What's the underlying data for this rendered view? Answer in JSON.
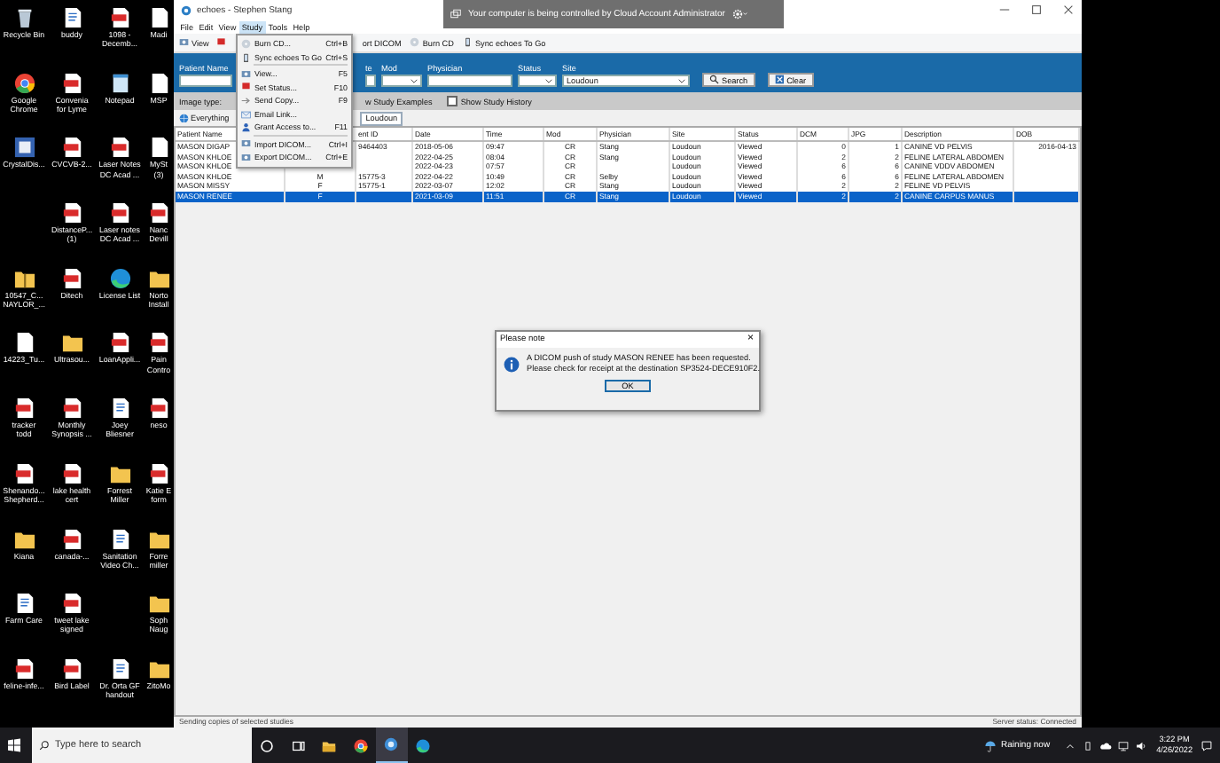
{
  "desktop": {
    "columns": [
      [
        {
          "kind": "recycle",
          "lines": [
            "Recycle Bin"
          ]
        },
        {
          "kind": "chrome",
          "lines": [
            "Google",
            "Chrome"
          ]
        },
        {
          "kind": "app",
          "lines": [
            "CrystalDis..."
          ]
        },
        {
          "kind": "zip",
          "lines": [
            "10547_C...",
            "NAYLOR_..."
          ],
          "after_gap": true
        },
        {
          "kind": "blank",
          "lines": [
            "14223_Tu..."
          ]
        },
        {
          "kind": "pdf",
          "lines": [
            "tracker",
            "todd"
          ]
        },
        {
          "kind": "pdf",
          "lines": [
            "Shenando...",
            "Shepherd..."
          ]
        },
        {
          "kind": "folder",
          "lines": [
            "Kiana"
          ]
        },
        {
          "kind": "doc",
          "lines": [
            "Farm Care"
          ]
        },
        {
          "kind": "pdf",
          "lines": [
            "feline-infe..."
          ]
        }
      ],
      [
        {
          "kind": "doc",
          "lines": [
            "buddy"
          ]
        },
        {
          "kind": "pdf",
          "lines": [
            "Convenia",
            "for Lyme"
          ]
        },
        {
          "kind": "pdf",
          "lines": [
            "CVCVB-2..."
          ]
        },
        {
          "kind": "pdf",
          "lines": [
            "DistanceP...",
            "(1)"
          ]
        },
        {
          "kind": "pdf",
          "lines": [
            "Ditech"
          ]
        },
        {
          "kind": "folder",
          "lines": [
            "Ultrasou..."
          ]
        },
        {
          "kind": "pdf",
          "lines": [
            "Monthly",
            "Synopsis ..."
          ]
        },
        {
          "kind": "pdf",
          "lines": [
            "lake health",
            "cert"
          ]
        },
        {
          "kind": "pdf",
          "lines": [
            "canada-..."
          ]
        },
        {
          "kind": "pdf",
          "lines": [
            "tweet lake",
            "signed"
          ]
        },
        {
          "kind": "pdf",
          "lines": [
            "Bird Label"
          ]
        }
      ],
      [
        {
          "kind": "pdf",
          "lines": [
            "1098 -",
            "Decemb..."
          ]
        },
        {
          "kind": "notepad",
          "lines": [
            "Notepad"
          ]
        },
        {
          "kind": "pdf",
          "lines": [
            "Laser Notes",
            "DC Acad ..."
          ]
        },
        {
          "kind": "pdf",
          "lines": [
            "Laser notes",
            "DC Acad ..."
          ]
        },
        {
          "kind": "edge",
          "lines": [
            "License List"
          ]
        },
        {
          "kind": "pdf",
          "lines": [
            "LoanAppli..."
          ]
        },
        {
          "kind": "doc",
          "lines": [
            "Joey",
            "Bliesner"
          ]
        },
        {
          "kind": "folder",
          "lines": [
            "Forrest",
            "Miller"
          ]
        },
        {
          "kind": "doc",
          "lines": [
            "Sanitation",
            "Video Ch..."
          ]
        },
        {
          "kind": "doc",
          "lines": [
            "Dr. Orta GF",
            "handout"
          ],
          "after_gap": true
        }
      ],
      [
        {
          "kind": "blank",
          "lines": [
            "Madi"
          ]
        },
        {
          "kind": "blank",
          "lines": [
            "MSP"
          ]
        },
        {
          "kind": "blank",
          "lines": [
            "MySt",
            "(3)"
          ]
        },
        {
          "kind": "pdf",
          "lines": [
            "Nanc",
            "Devill"
          ]
        },
        {
          "kind": "folder",
          "lines": [
            "Norto",
            "Install"
          ]
        },
        {
          "kind": "pdf",
          "lines": [
            "Pain",
            "Contro"
          ]
        },
        {
          "kind": "pdf",
          "lines": [
            "neso"
          ]
        },
        {
          "kind": "pdf",
          "lines": [
            "Katie E",
            "form"
          ]
        },
        {
          "kind": "folder",
          "lines": [
            "Forre",
            "miller"
          ]
        },
        {
          "kind": "folder",
          "lines": [
            "Soph",
            "Naug"
          ]
        },
        {
          "kind": "folder",
          "lines": [
            "ZitoMo"
          ]
        }
      ]
    ]
  },
  "window": {
    "title": "echoes  -  Stephen Stang"
  },
  "remote_banner": {
    "text": "Your computer is being controlled by Cloud Account Administrator"
  },
  "menubar": {
    "menus": [
      {
        "label": "File",
        "selected": false
      },
      {
        "label": "Edit",
        "selected": false
      },
      {
        "label": "View",
        "selected": false
      },
      {
        "label": "Study",
        "selected": true
      },
      {
        "label": "Tools",
        "selected": false
      },
      {
        "label": "Help",
        "selected": false
      }
    ]
  },
  "toolbar": {
    "left": [
      {
        "kind": "view",
        "label": "View"
      },
      {
        "kind": "flag"
      }
    ],
    "right": [
      {
        "kind": "export",
        "label": "ort DICOM"
      },
      {
        "kind": "disc",
        "label": "Burn CD"
      },
      {
        "kind": "sync",
        "label": "Sync echoes To Go"
      }
    ]
  },
  "search_panel": {
    "fields": [
      {
        "label": "Patient Name",
        "kind": "text"
      },
      {
        "label": "te",
        "kind": "text"
      },
      {
        "label": "Mod",
        "kind": "dropdown"
      },
      {
        "label": "Physician",
        "kind": "text"
      },
      {
        "label": "Status",
        "kind": "dropdown"
      },
      {
        "label": "Site",
        "kind": "dropdown",
        "value": "Loudoun"
      }
    ],
    "buttons": [
      {
        "kind": "search",
        "label": "Search"
      },
      {
        "kind": "clear",
        "label": "Clear"
      }
    ]
  },
  "filter_bar": {
    "image_type_label": "Image type:",
    "examples_label": "w Study Examples",
    "history": {
      "label": "Show Study History",
      "checked": false
    }
  },
  "tabs": [
    {
      "label": "Everything",
      "selected": false
    },
    {
      "label": "Loudoun",
      "selected": true
    }
  ],
  "table": {
    "columns": [
      "Patient Name",
      null,
      "ent ID",
      "Date",
      "Time",
      "Mod",
      "Physician",
      "Site",
      "Status",
      "DCM",
      "JPG",
      "Description",
      "DOB"
    ],
    "rows": [
      {
        "selected": false,
        "cells": [
          "MASON DIGAP",
          null,
          "9464403",
          "2018-05-06",
          "09:47",
          "CR",
          "Stang",
          "Loudoun",
          "Viewed",
          "0",
          "1",
          "CANINE VD PELVIS",
          "2016-04-13"
        ]
      },
      {
        "selected": false,
        "cells": [
          "MASON KHLOE",
          null,
          null,
          "2022-04-25",
          "08:04",
          "CR",
          "Stang",
          "Loudoun",
          "Viewed",
          "2",
          "2",
          "FELINE LATERAL ABDOMEN",
          null
        ]
      },
      {
        "selected": false,
        "cells": [
          "MASON KHLOE",
          null,
          null,
          "2022-04-23",
          "07:57",
          "CR",
          null,
          "Loudoun",
          "Viewed",
          "6",
          "6",
          "CANINE VDDV ABDOMEN",
          null
        ]
      },
      {
        "selected": false,
        "cells": [
          "MASON KHLOE",
          "M",
          "15775-3",
          "2022-04-22",
          "10:49",
          "CR",
          "Selby",
          "Loudoun",
          "Viewed",
          "6",
          "6",
          "FELINE LATERAL ABDOMEN",
          null
        ]
      },
      {
        "selected": false,
        "cells": [
          "MASON MISSY",
          "F",
          "15775-1",
          "2022-03-07",
          "12:02",
          "CR",
          "Stang",
          "Loudoun",
          "Viewed",
          "2",
          "2",
          "FELINE VD PELVIS",
          null
        ]
      },
      {
        "selected": true,
        "cells": [
          "MASON RENEE",
          "F",
          null,
          "2021-03-09",
          "11:51",
          "CR",
          "Stang",
          "Loudoun",
          "Viewed",
          "2",
          "2",
          "CANINE CARPUS MANUS",
          null
        ]
      }
    ]
  },
  "study_menu": {
    "items": [
      {
        "kind": "disc",
        "label": "Burn CD...",
        "shortcut": "Ctrl+B"
      },
      {
        "kind": "sync",
        "label": "Sync echoes To Go",
        "shortcut": "Ctrl+S"
      },
      {
        "kind": "view",
        "label": "View...",
        "shortcut": "F5",
        "separator_before": true
      },
      {
        "kind": "flag",
        "label": "Set Status...",
        "shortcut": "F10"
      },
      {
        "kind": "send",
        "label": "Send Copy...",
        "shortcut": "F9"
      },
      {
        "kind": "email",
        "label": "Email Link..."
      },
      {
        "kind": "person",
        "label": "Grant Access to...",
        "shortcut": "F11"
      },
      {
        "kind": "import",
        "label": "Import DICOM...",
        "shortcut": "Ctrl+I",
        "separator_before": true
      },
      {
        "kind": "export",
        "label": "Export DICOM...",
        "shortcut": "Ctrl+E"
      }
    ]
  },
  "dialog": {
    "title": "Please note",
    "close": "×",
    "lines": [
      "A DICOM push of study MASON RENEE has been requested.",
      "Please check for receipt at the destination SP3524-DECE910F2."
    ],
    "button": "OK"
  },
  "status_bar": {
    "left": "Sending copies of selected studies",
    "right": "Server status: Connected"
  },
  "taskbar": {
    "search_placeholder": "Type here to search",
    "apps": [
      {
        "kind": "cortana",
        "selected": false
      },
      {
        "kind": "taskview",
        "selected": false
      },
      {
        "kind": "explorer",
        "selected": false
      },
      {
        "kind": "chrome",
        "selected": false
      },
      {
        "kind": "echoes",
        "selected": true
      },
      {
        "kind": "edge",
        "selected": false
      }
    ],
    "weather": "Raining now",
    "time": "3:22 PM",
    "date": "4/26/2022"
  }
}
